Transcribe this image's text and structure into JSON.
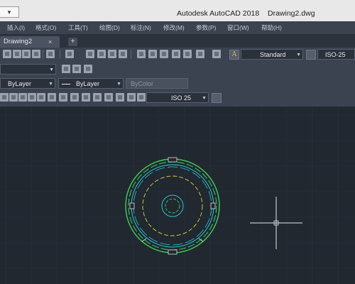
{
  "titlebar": {
    "dropdown_glyph": "▾",
    "app_name": "Autodesk AutoCAD 2018",
    "file_name": "Drawing2.dwg"
  },
  "menubar": {
    "items": [
      "插入(I)",
      "格式(O)",
      "工具(T)",
      "绘图(D)",
      "标注(N)",
      "修改(M)",
      "参数(P)",
      "窗口(W)",
      "帮助(H)"
    ]
  },
  "tabs": {
    "active_label": "Drawing2",
    "close_glyph": "×",
    "new_tab_glyph": "+"
  },
  "toolbar": {
    "text_style": "Standard",
    "dim_style": "ISO-25",
    "linetype": "ByLayer",
    "lineweight": "ByLayer",
    "plot_style": "ByColor",
    "dim_style_2": "ISO 25",
    "text_style_icon": "A"
  },
  "colors": {
    "canvas_background": "#212830",
    "grid_line": "#2a3340",
    "crosshair": "#e8e8e8",
    "green_geometry": "#3ecf5a",
    "cyan_geometry": "#28c8d8",
    "yellow_geometry": "#d8d840",
    "white_geometry": "#e0e0e0"
  },
  "icons": [
    "new-file-icon",
    "open-icon",
    "save-icon",
    "plot-icon",
    "undo-icon",
    "redo-icon",
    "pan-icon",
    "zoom-icon",
    "properties-icon",
    "layer-icon",
    "dimension-icon",
    "help-icon"
  ]
}
